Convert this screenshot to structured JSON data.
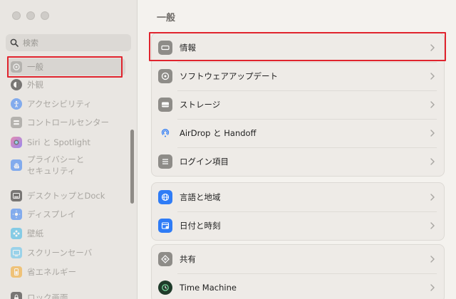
{
  "window": {
    "controls": [
      "close",
      "minimize",
      "zoom"
    ]
  },
  "search": {
    "placeholder": "検索"
  },
  "sidebar": {
    "items": [
      {
        "label": "一般",
        "icon": "gear-icon",
        "selected": true
      },
      {
        "label": "外観",
        "icon": "appearance-icon"
      },
      {
        "label": "アクセシビリティ",
        "icon": "accessibility-icon"
      },
      {
        "label": "コントロールセンター",
        "icon": "control-center-icon"
      },
      {
        "label": "Siri と Spotlight",
        "icon": "siri-icon"
      },
      {
        "label_line1": "プライバシーと",
        "label_line2": "セキュリティ",
        "icon": "hand-icon"
      },
      {
        "label": "デスクトップとDock",
        "icon": "dock-icon"
      },
      {
        "label": "ディスプレイ",
        "icon": "display-icon"
      },
      {
        "label": "壁紙",
        "icon": "wallpaper-icon"
      },
      {
        "label": "スクリーンセーバ",
        "icon": "screensaver-icon"
      },
      {
        "label": "省エネルギー",
        "icon": "battery-icon"
      },
      {
        "label": "ロック画面",
        "icon": "lock-icon"
      }
    ]
  },
  "main": {
    "title": "一般",
    "groups": [
      {
        "rows": [
          {
            "label": "情報",
            "icon": "about-icon"
          },
          {
            "label": "ソフトウェアアップデート",
            "icon": "software-update-icon"
          },
          {
            "label": "ストレージ",
            "icon": "storage-icon"
          },
          {
            "label": "AirDrop と Handoff",
            "icon": "airdrop-icon"
          },
          {
            "label": "ログイン項目",
            "icon": "login-items-icon"
          }
        ]
      },
      {
        "rows": [
          {
            "label": "言語と地域",
            "icon": "globe-icon"
          },
          {
            "label": "日付と時刻",
            "icon": "calendar-clock-icon"
          }
        ]
      },
      {
        "rows": [
          {
            "label": "共有",
            "icon": "sharing-icon"
          },
          {
            "label": "Time Machine",
            "icon": "time-machine-icon"
          }
        ]
      }
    ]
  },
  "colors": {
    "highlight": "#e0242e",
    "accent_blue": "#2f7cf6",
    "sidebar_bg": "#e9e6e2",
    "main_bg": "#f4f2ee"
  }
}
